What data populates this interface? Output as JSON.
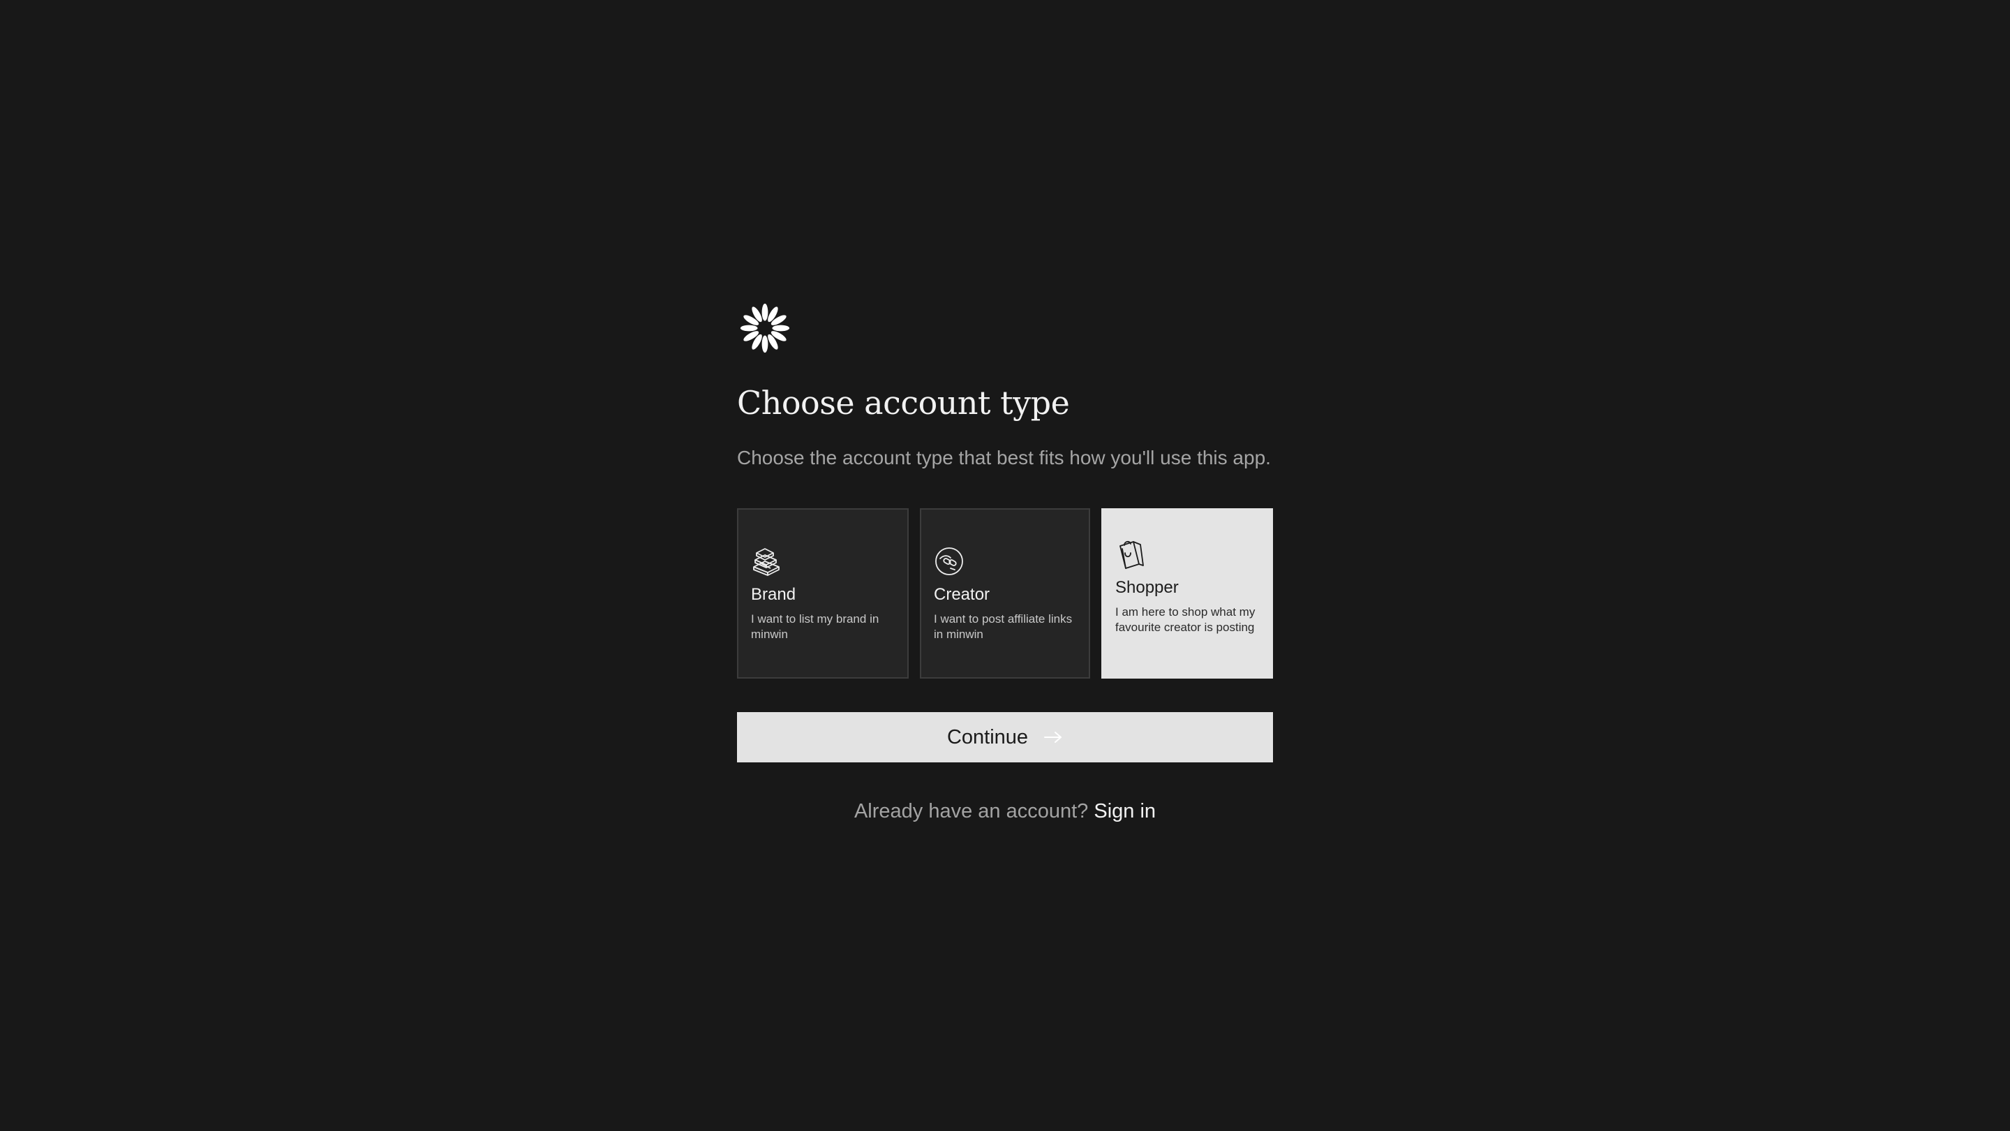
{
  "app": {
    "logo_icon": "daisy-flower-icon"
  },
  "header": {
    "title": "Choose account type",
    "subtitle": "Choose the account type that best fits how you'll use this app."
  },
  "account_types": [
    {
      "id": "brand",
      "icon": "stacked-boxes-icon",
      "title": "Brand",
      "description": "I want to list my brand in minwin",
      "selected": false
    },
    {
      "id": "creator",
      "icon": "link-badge-icon",
      "title": "Creator",
      "description": "I want to post affiliate links in minwin",
      "selected": false
    },
    {
      "id": "shopper",
      "icon": "shopping-bag-icon",
      "title": "Shopper",
      "description": "I am here to shop what my favourite creator is posting",
      "selected": true
    }
  ],
  "actions": {
    "continue_label": "Continue",
    "continue_icon": "arrow-right-icon"
  },
  "footer": {
    "prompt": "Already have an account?",
    "signin_label": "Sign in"
  },
  "colors": {
    "background": "#181818",
    "card_background": "#252525",
    "card_border": "#3c3c3c",
    "selected_card": "#e4e4e4",
    "button_background": "#e3e3e3",
    "text_primary": "#f2f2f2",
    "text_muted": "#a5a5a5"
  }
}
